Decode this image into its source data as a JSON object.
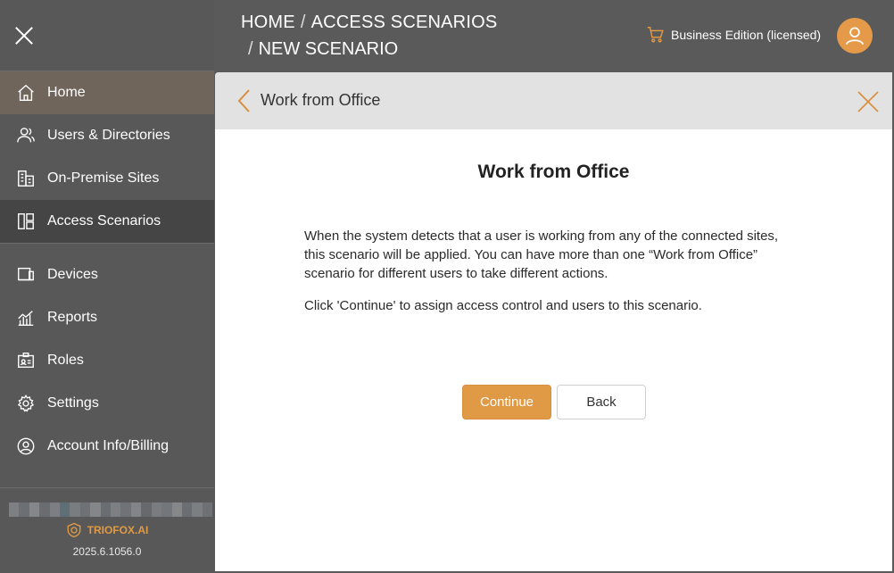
{
  "sidebar": {
    "home": "Home",
    "users": "Users & Directories",
    "sites": "On-Premise Sites",
    "scenarios": "Access Scenarios",
    "devices": "Devices",
    "reports": "Reports",
    "roles": "Roles",
    "settings": "Settings",
    "account": "Account Info/Billing",
    "brand": "TRIOFOX.AI",
    "version": "2025.6.1056.0"
  },
  "header": {
    "crumb_home": "HOME",
    "crumb_scenarios": "ACCESS SCENARIOS",
    "crumb_new": "NEW SCENARIO",
    "edition": "Business Edition (licensed)"
  },
  "panel": {
    "header_title": "Work from Office",
    "title": "Work from Office",
    "description": "When the system detects that a user is working from any of the connected sites, this scenario will be applied. You can have more than one “Work from Office” scenario for different users to take different actions.",
    "instruction": "Click 'Continue' to assign access control and users to this scenario.",
    "continue_label": "Continue",
    "back_label": "Back"
  },
  "colors": {
    "accent": "#e09a45",
    "sidebar_bg": "#585858",
    "home_highlight": "#6f655a",
    "active_bg": "#454545"
  }
}
